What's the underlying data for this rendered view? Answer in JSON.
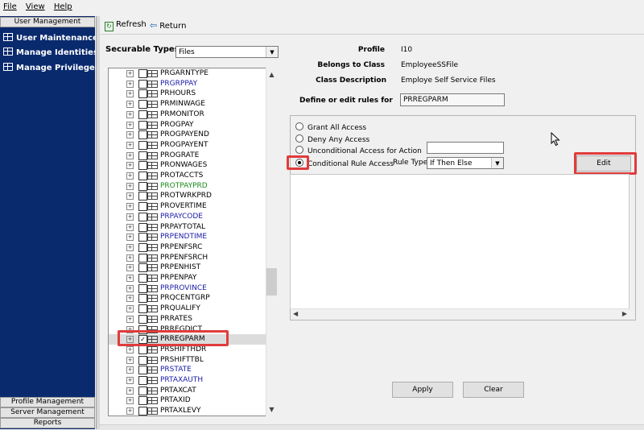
{
  "menubar": {
    "file": "File",
    "view": "View",
    "help": "Help"
  },
  "leftnav": {
    "top_header": "User Management",
    "items": [
      {
        "label": "User Maintenance"
      },
      {
        "label": "Manage Identities"
      },
      {
        "label": "Manage Privileged ..."
      }
    ],
    "bottom_headers": [
      "Profile Management",
      "Server Management",
      "Reports"
    ]
  },
  "toolbar": {
    "refresh": "Refresh",
    "return": "Return"
  },
  "securable_types": {
    "label": "Securable Types",
    "value": "Files"
  },
  "tree_items": [
    {
      "name": "PRGARNTYPE",
      "color": "#000000",
      "checked": false
    },
    {
      "name": "PRGRPPAY",
      "color": "#1a1aa8",
      "checked": false
    },
    {
      "name": "PRHOURS",
      "color": "#000000",
      "checked": false
    },
    {
      "name": "PRMINWAGE",
      "color": "#000000",
      "checked": false
    },
    {
      "name": "PRMONITOR",
      "color": "#000000",
      "checked": false
    },
    {
      "name": "PROGPAY",
      "color": "#000000",
      "checked": false
    },
    {
      "name": "PROGPAYEND",
      "color": "#000000",
      "checked": false
    },
    {
      "name": "PROGPAYENT",
      "color": "#000000",
      "checked": false
    },
    {
      "name": "PROGRATE",
      "color": "#000000",
      "checked": false
    },
    {
      "name": "PRONWAGES",
      "color": "#000000",
      "checked": false
    },
    {
      "name": "PROTACCTS",
      "color": "#000000",
      "checked": false
    },
    {
      "name": "PROTPAYPRD",
      "color": "#1a8a1a",
      "checked": false
    },
    {
      "name": "PROTWRKPRD",
      "color": "#000000",
      "checked": false
    },
    {
      "name": "PROVERTIME",
      "color": "#000000",
      "checked": false
    },
    {
      "name": "PRPAYCODE",
      "color": "#1a1aa8",
      "checked": false
    },
    {
      "name": "PRPAYTOTAL",
      "color": "#000000",
      "checked": false
    },
    {
      "name": "PRPENDTIME",
      "color": "#1a1aa8",
      "checked": false
    },
    {
      "name": "PRPENFSRC",
      "color": "#000000",
      "checked": false
    },
    {
      "name": "PRPENFSRCH",
      "color": "#000000",
      "checked": false
    },
    {
      "name": "PRPENHIST",
      "color": "#000000",
      "checked": false
    },
    {
      "name": "PRPENPAY",
      "color": "#000000",
      "checked": false
    },
    {
      "name": "PRPROVINCE",
      "color": "#1a1aa8",
      "checked": false
    },
    {
      "name": "PRQCENTGRP",
      "color": "#000000",
      "checked": false
    },
    {
      "name": "PRQUALIFY",
      "color": "#000000",
      "checked": false
    },
    {
      "name": "PRRATES",
      "color": "#000000",
      "checked": false
    },
    {
      "name": "PRREGDICT",
      "color": "#000000",
      "checked": false
    },
    {
      "name": "PRREGPARM",
      "color": "#000000",
      "checked": true
    },
    {
      "name": "PRSHIFTHDR",
      "color": "#000000",
      "checked": false
    },
    {
      "name": "PRSHIFTTBL",
      "color": "#000000",
      "checked": false
    },
    {
      "name": "PRSTATE",
      "color": "#1a1aa8",
      "checked": false
    },
    {
      "name": "PRTAXAUTH",
      "color": "#1a1aa8",
      "checked": false
    },
    {
      "name": "PRTAXCAT",
      "color": "#000000",
      "checked": false
    },
    {
      "name": "PRTAXID",
      "color": "#000000",
      "checked": false
    },
    {
      "name": "PRTAXLEVY",
      "color": "#000000",
      "checked": false
    }
  ],
  "profile": {
    "profile_label": "Profile",
    "profile_value": "I10",
    "class_label": "Belongs to Class",
    "class_value": "EmployeeSSFile",
    "desc_label": "Class Description",
    "desc_value": "Employe Self Service Files",
    "rules_label": "Define or edit rules for",
    "rules_value": "PRREGPARM"
  },
  "access": {
    "grant_all": "Grant All Access",
    "deny_any": "Deny Any Access",
    "unconditional": "Unconditional Access for Action",
    "conditional": "Conditional Rule Access",
    "rule_type_label": "Rule Type",
    "rule_type_value": "If Then Else",
    "edit_button": "Edit"
  },
  "buttons": {
    "apply": "Apply",
    "clear": "Clear"
  },
  "colors": {
    "nav_bg": "#0a2a6e",
    "highlight": "#e03c3c"
  }
}
